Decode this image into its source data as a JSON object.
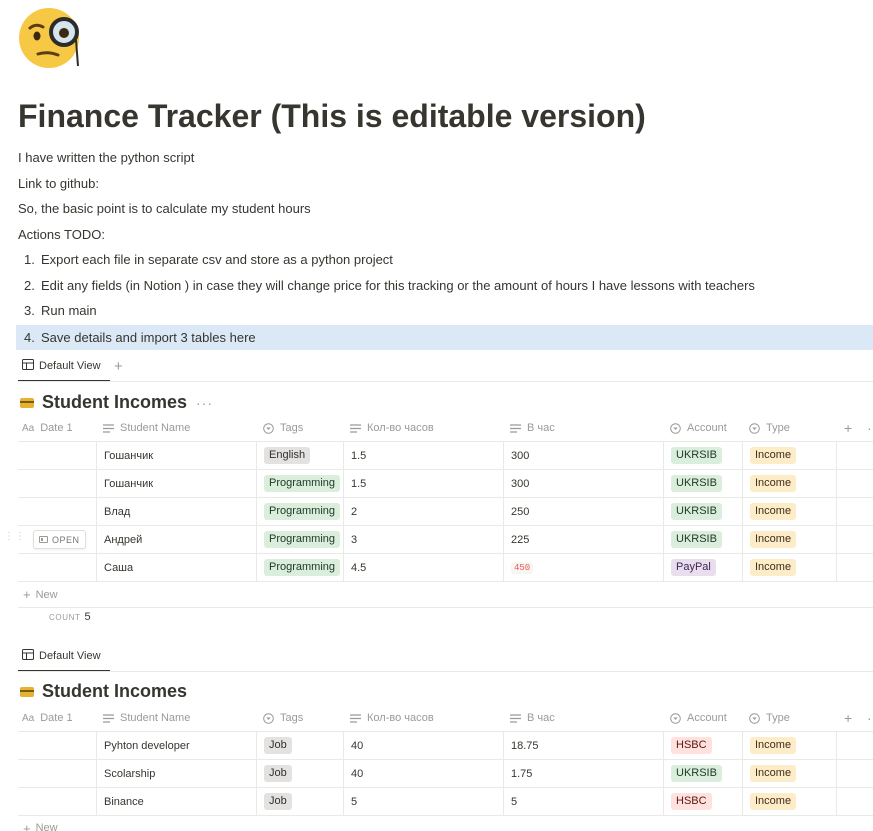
{
  "page": {
    "icon": "monocle-face-icon",
    "title": "Finance Tracker (This is editable version)",
    "paragraphs": [
      "I have written the python script",
      "Link to github:",
      "So, the basic point is to calculate my student hours",
      "Actions TODO:"
    ],
    "todo": [
      {
        "num": "1.",
        "text": "Export each file in separate csv and store as a python project"
      },
      {
        "num": "2.",
        "text": "Edit any fields (in Notion ) in case they will change price for this tracking or the amount of hours I have lessons with teachers"
      },
      {
        "num": "3.",
        "text": "Run main"
      },
      {
        "num": "4.",
        "text": "Save details and import 3 tables here"
      }
    ]
  },
  "columns": {
    "date": "Date 1",
    "name": "Student Name",
    "tags": "Tags",
    "hours": "Кол-во часов",
    "rate": "В час",
    "account": "Account",
    "type": "Type"
  },
  "db1": {
    "view_label": "Default View",
    "add_view": "+",
    "title": "Student Incomes",
    "more": "···",
    "open_label": "OPEN",
    "rows": [
      {
        "date": "",
        "name": "Гошанчик",
        "tag": "English",
        "hours": "1.5",
        "rate": "300",
        "account": "UKRSIB",
        "type": "Income"
      },
      {
        "date": "",
        "name": "Гошанчик",
        "tag": "Programming",
        "hours": "1.5",
        "rate": "300",
        "account": "UKRSIB",
        "type": "Income"
      },
      {
        "date": "",
        "name": "Влад",
        "tag": "Programming",
        "hours": "2",
        "rate": "250",
        "account": "UKRSIB",
        "type": "Income"
      },
      {
        "date": "",
        "name": "Андрей",
        "tag": "Programming",
        "hours": "3",
        "rate": "225",
        "account": "UKRSIB",
        "type": "Income"
      },
      {
        "date": "",
        "name": "Саша",
        "tag": "Programming",
        "hours": "4.5",
        "rate": "450",
        "account": "PayPal",
        "type": "Income"
      }
    ],
    "new_label": "New",
    "count_label": "COUNT",
    "count_value": "5"
  },
  "db2": {
    "view_label": "Default View",
    "title": "Student Incomes",
    "rows": [
      {
        "date": "",
        "name": "Pyhton developer",
        "tag": "Job",
        "hours": "40",
        "rate": "18.75",
        "account": "HSBC",
        "type": "Income"
      },
      {
        "date": "",
        "name": "Scolarship",
        "tag": "Job",
        "hours": "40",
        "rate": "1.75",
        "account": "UKRSIB",
        "type": "Income"
      },
      {
        "date": "",
        "name": "Binance",
        "tag": "Job",
        "hours": "5",
        "rate": "5",
        "account": "HSBC",
        "type": "Income"
      }
    ],
    "new_label": "New"
  },
  "colors": {
    "text": "#37352f",
    "muted": "#9b9a97",
    "highlight": "#dbe9f7",
    "tag_gray": "#e3e2e0",
    "tag_green": "#dbeddb",
    "tag_yellow": "#fdecc8",
    "tag_purple": "#e8deee",
    "tag_red": "#ffe2dd",
    "error": "#eb5757"
  }
}
